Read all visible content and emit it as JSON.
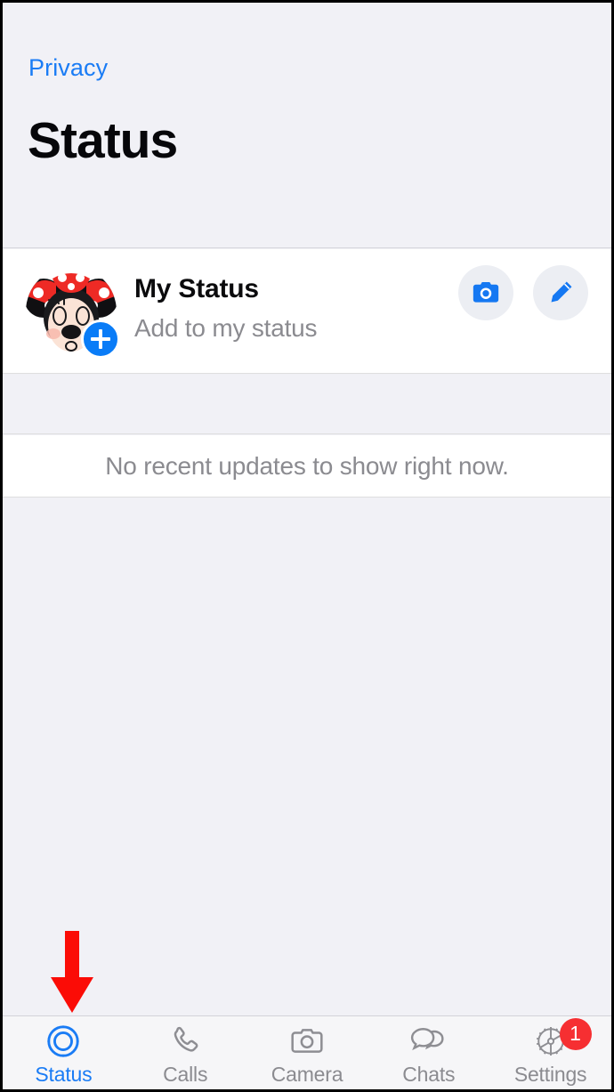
{
  "header": {
    "back_label": "Privacy",
    "title": "Status"
  },
  "my_status": {
    "title": "My Status",
    "subtitle": "Add to my status",
    "avatar_name": "minnie-mouse-avatar",
    "add_badge": "+",
    "camera_button_label": "camera-icon",
    "edit_button_label": "pencil-icon"
  },
  "empty_state": {
    "message": "No recent updates to show right now."
  },
  "annotation": {
    "arrow_color": "#fb0c06",
    "points_to": "Status"
  },
  "tabbar": {
    "active_tab": "Status",
    "items": [
      {
        "label": "Status",
        "icon": "status-rings-icon",
        "badge": ""
      },
      {
        "label": "Calls",
        "icon": "phone-icon",
        "badge": ""
      },
      {
        "label": "Camera",
        "icon": "camera-icon",
        "badge": ""
      },
      {
        "label": "Chats",
        "icon": "chat-bubbles-icon",
        "badge": ""
      },
      {
        "label": "Settings",
        "icon": "gear-icon",
        "badge": "1"
      }
    ]
  },
  "colors": {
    "accent_blue": "#1a7cf5",
    "badge_red": "#f62f32",
    "background": "#f1f1f6",
    "card": "#ffffff",
    "muted_text": "#8b8b90"
  }
}
